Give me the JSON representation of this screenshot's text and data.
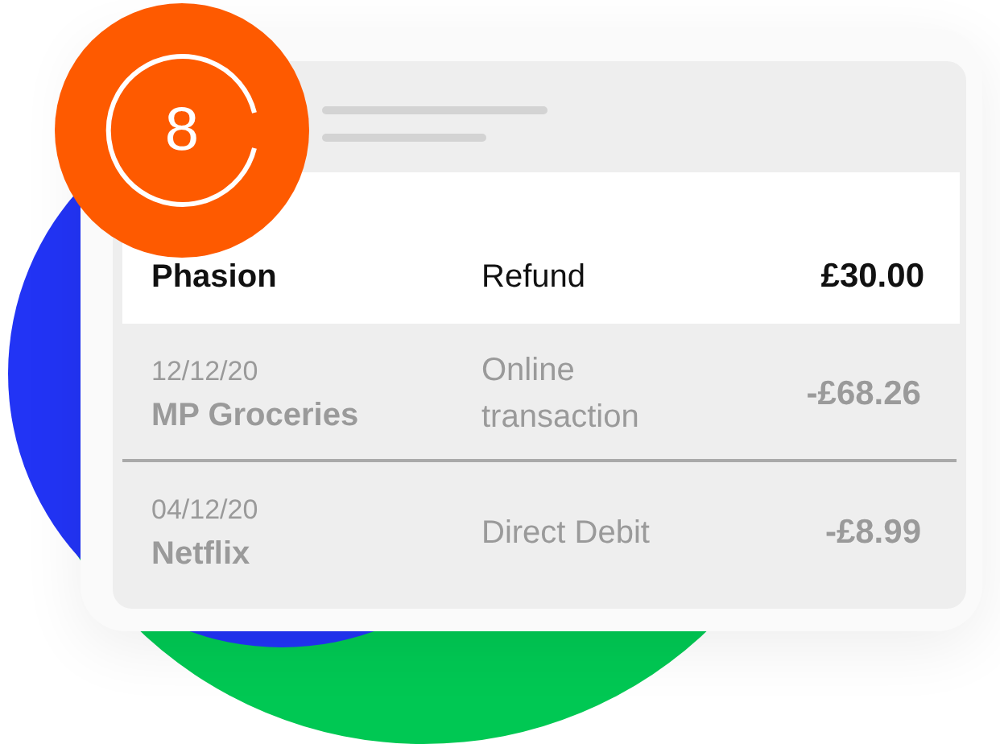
{
  "badge": {
    "number": "8"
  },
  "transactions": [
    {
      "name": "Phasion",
      "type": "Refund",
      "amount": "£30.00",
      "selected": true
    },
    {
      "date": "12/12/20",
      "name": "MP Groceries",
      "type": "Online transaction",
      "amount": "-£68.26",
      "selected": false
    },
    {
      "date": "04/12/20",
      "name": "Netflix",
      "type": "Direct Debit",
      "amount": "-£8.99",
      "selected": false
    }
  ]
}
